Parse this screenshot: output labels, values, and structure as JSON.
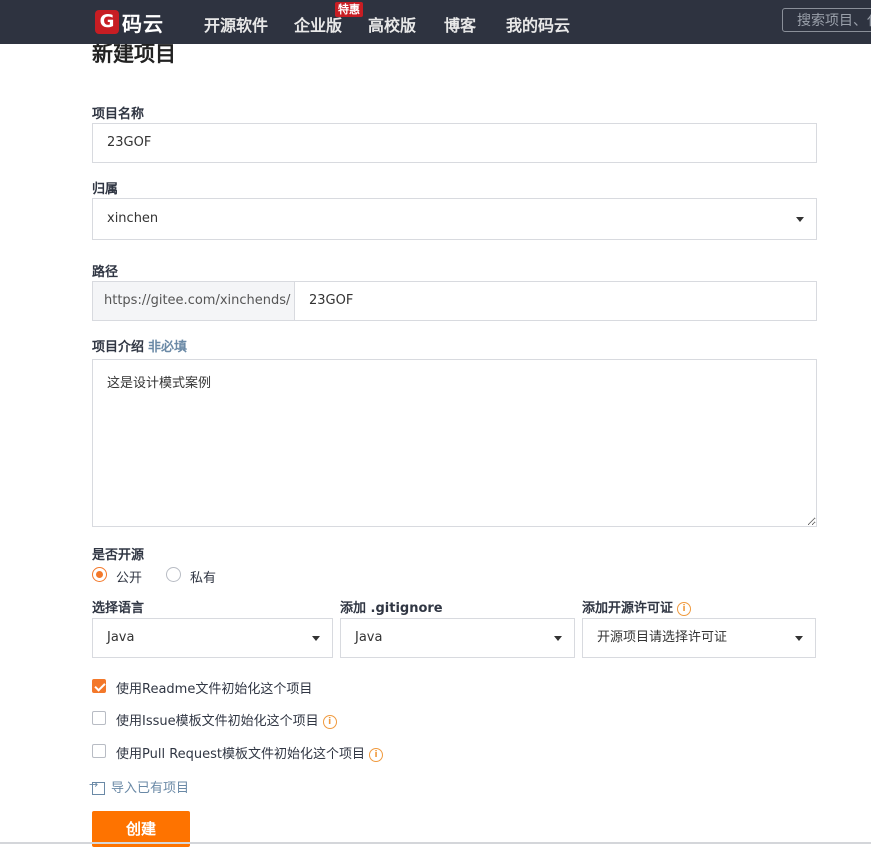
{
  "nav": {
    "logo_mark": "G",
    "logo_text": "码云",
    "items": [
      "开源软件",
      "企业版",
      "高校版",
      "博客",
      "我的码云"
    ],
    "badge": "特惠",
    "search_placeholder": "搜索项目、代码"
  },
  "form": {
    "title": "新建项目",
    "name_label": "项目名称",
    "name_value": "23GOF",
    "owner_label": "归属",
    "owner_value": "xinchen",
    "path_label": "路径",
    "path_prefix": "https://gitee.com/xinchends/",
    "path_value": "23GOF",
    "desc_label": "项目介绍",
    "desc_optional": "非必填",
    "desc_value": "这是设计模式案例",
    "open_label": "是否开源",
    "radio_public": "公开",
    "radio_private": "私有",
    "lang_label": "选择语言",
    "lang_value": "Java",
    "gitignore_label": "添加 .gitignore",
    "gitignore_value": "Java",
    "license_label": "添加开源许可证",
    "license_value": "开源项目请选择许可证",
    "check_readme": "使用Readme文件初始化这个项目",
    "check_issue": "使用Issue模板文件初始化这个项目",
    "check_pr": "使用Pull Request模板文件初始化这个项目",
    "import_link": "导入已有项目",
    "create_button": "创建"
  },
  "colors": {
    "nav_bg": "#2e3340",
    "accent": "#fe7300",
    "brand_red": "#c71d23"
  }
}
